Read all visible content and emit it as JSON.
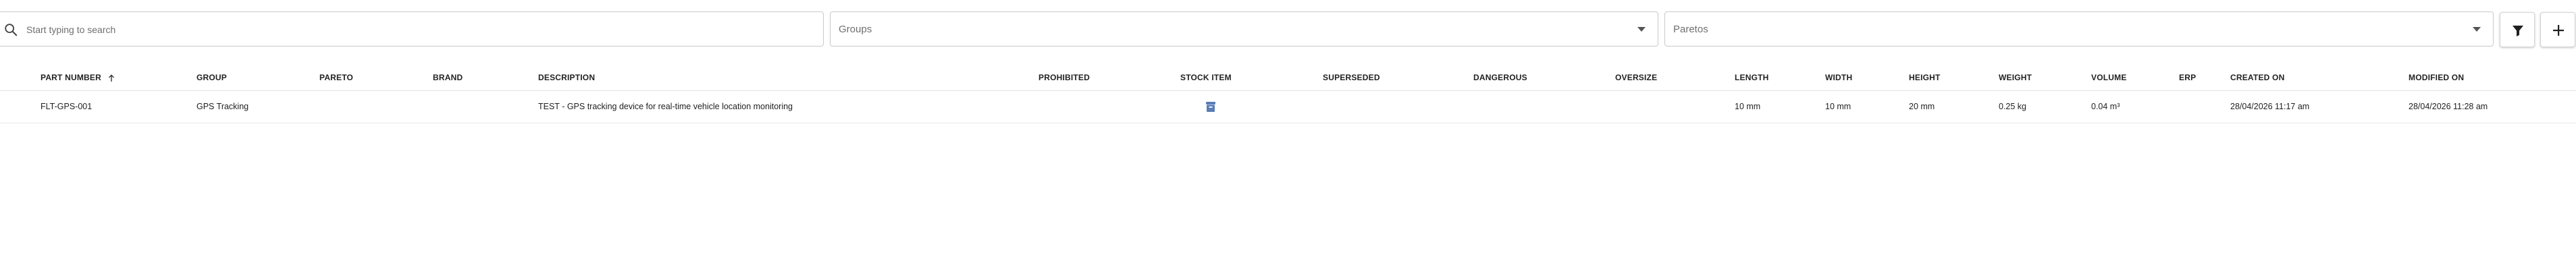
{
  "search": {
    "placeholder": "Start typing to search"
  },
  "groups_select": {
    "placeholder": "Groups"
  },
  "paretos_select": {
    "placeholder": "Paretos"
  },
  "columns": {
    "part_number": "PART NUMBER",
    "group": "GROUP",
    "pareto": "PARETO",
    "brand": "BRAND",
    "description": "DESCRIPTION",
    "prohibited": "PROHIBITED",
    "stock_item": "STOCK ITEM",
    "superseded": "SUPERSEDED",
    "dangerous": "DANGEROUS",
    "oversize": "OVERSIZE",
    "length": "LENGTH",
    "width": "WIDTH",
    "height": "HEIGHT",
    "weight": "WEIGHT",
    "volume": "VOLUME",
    "erp": "ERP",
    "created_on": "CREATED ON",
    "modified_on": "MODIFIED ON"
  },
  "sort": {
    "column": "part_number",
    "direction": "ascending",
    "icon": "arrow-up-icon"
  },
  "rows": [
    {
      "part_number": "FLT-GPS-001",
      "group": "GPS Tracking",
      "pareto": "",
      "brand": "",
      "description": "TEST - GPS tracking device for real-time vehicle location monitoring",
      "prohibited": "",
      "stock_item_icon": "inventory-icon",
      "superseded": "",
      "dangerous": "",
      "oversize": "",
      "length": "10 mm",
      "width": "10 mm",
      "height": "20 mm",
      "weight": "0.25 kg",
      "volume": "0.04 m³",
      "erp": "",
      "created_on": "28/04/2026 11:17 am",
      "modified_on": "28/04/2026 11:28 am"
    }
  ],
  "icons": {
    "search": "search-icon",
    "dropdown": "chevron-down-icon",
    "filter": "filter-icon",
    "add": "plus-icon"
  },
  "colors": {
    "accent": "#1f1f1f",
    "stock_icon": "#5a7db5"
  }
}
